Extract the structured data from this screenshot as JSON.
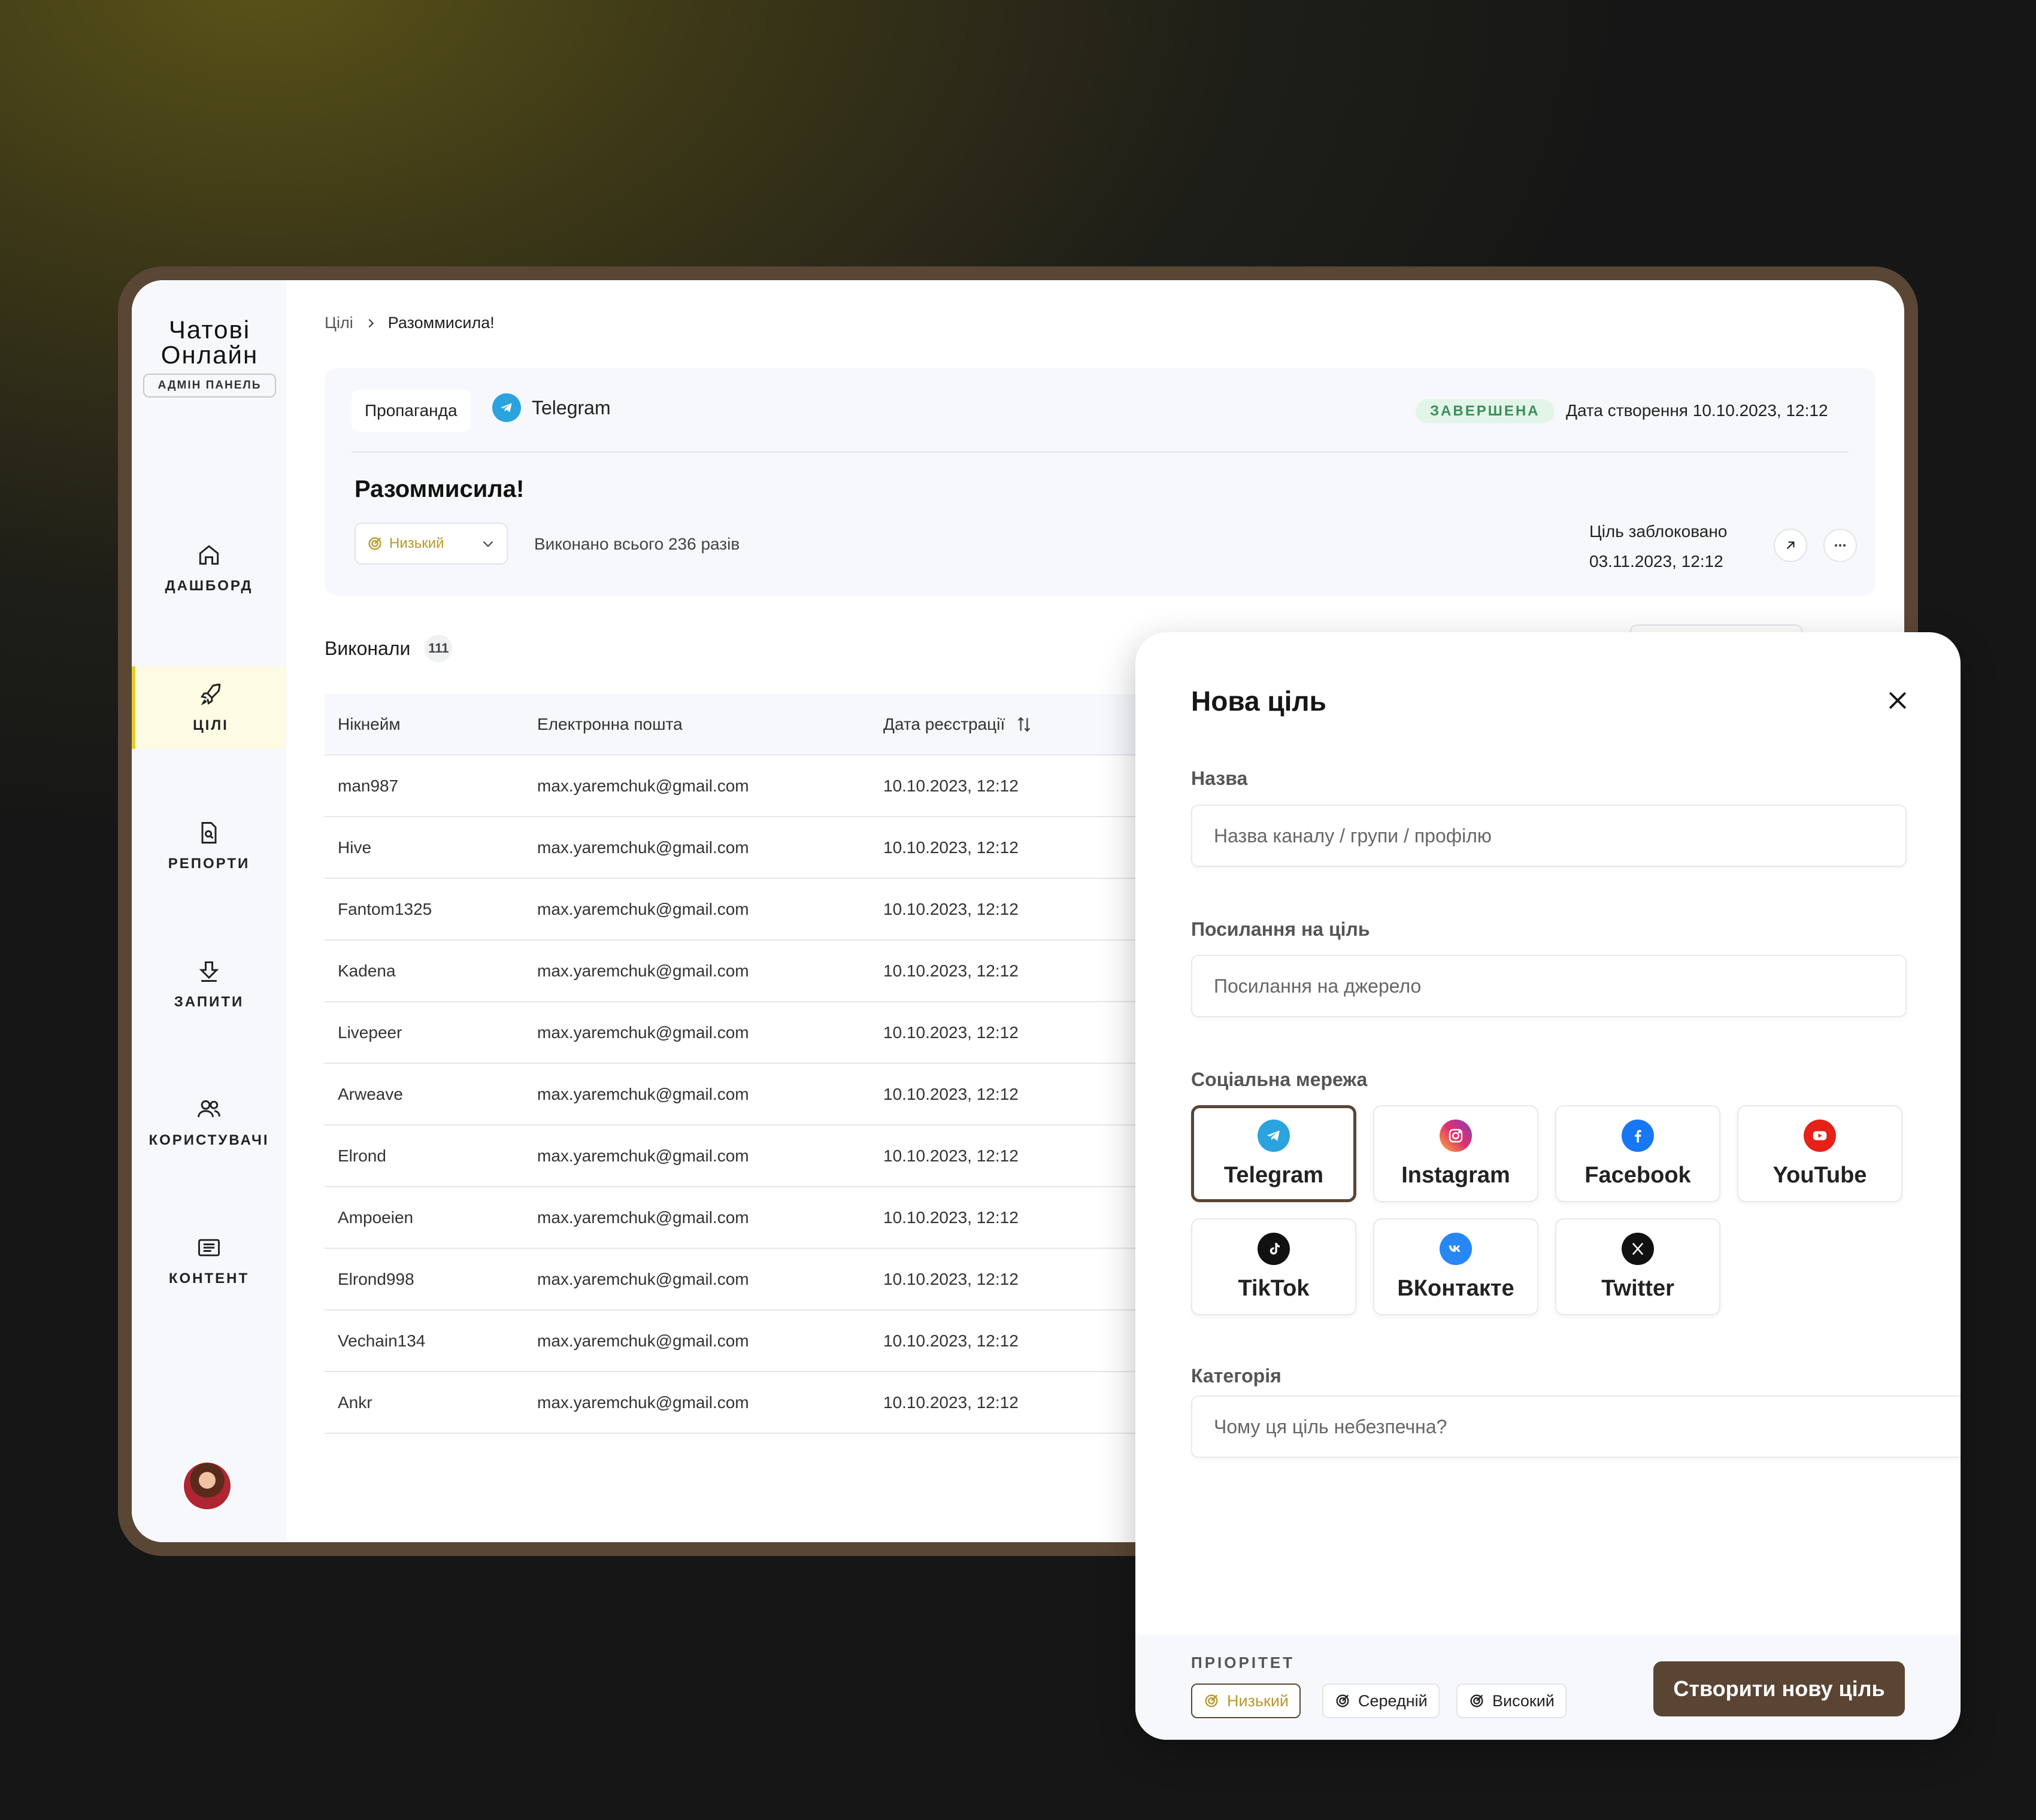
{
  "app": {
    "logo_top": "Чатові",
    "logo_bottom": "Онлайн",
    "badge": "АДМІН ПАНЕЛЬ"
  },
  "nav": [
    {
      "label": "ДАШБОРД",
      "icon": "home-icon",
      "active": false
    },
    {
      "label": "ЦІЛІ",
      "icon": "rocket-icon",
      "active": true
    },
    {
      "label": "РЕПОРТИ",
      "icon": "report-icon",
      "active": false
    },
    {
      "label": "ЗАПИТИ",
      "icon": "download-icon",
      "active": false
    },
    {
      "label": "КОРИСТУВАЧІ",
      "icon": "users-icon",
      "active": false
    },
    {
      "label": "КОНТЕНТ",
      "icon": "content-icon",
      "active": false
    }
  ],
  "breadcrumb": {
    "root": "Цілі",
    "current": "Разоммисила!"
  },
  "target": {
    "category": "Пропаганда",
    "network": "Telegram",
    "status": "ЗАВЕРШЕНА",
    "created": "Дата створення 10.10.2023, 12:12",
    "title": "Разоммисила!",
    "priority": "Низький",
    "done": "Виконано всього 236 разів",
    "blocked_label": "Ціль заблоковано",
    "blocked_date": "03.11.2023, 12:12"
  },
  "executors": {
    "label": "Виконали",
    "count": "111"
  },
  "table": {
    "headers": [
      "Нікнейм",
      "Електронна пошта",
      "Дата реєстрації"
    ],
    "rows": [
      [
        "man987",
        "max.yaremchuk@gmail.com",
        "10.10.2023, 12:12"
      ],
      [
        "Hive",
        "max.yaremchuk@gmail.com",
        "10.10.2023, 12:12"
      ],
      [
        "Fantom1325",
        "max.yaremchuk@gmail.com",
        "10.10.2023, 12:12"
      ],
      [
        "Kadena",
        "max.yaremchuk@gmail.com",
        "10.10.2023, 12:12"
      ],
      [
        "Livepeer",
        "max.yaremchuk@gmail.com",
        "10.10.2023, 12:12"
      ],
      [
        "Arweave",
        "max.yaremchuk@gmail.com",
        "10.10.2023, 12:12"
      ],
      [
        "Elrond",
        "max.yaremchuk@gmail.com",
        "10.10.2023, 12:12"
      ],
      [
        "Ampoeien",
        "max.yaremchuk@gmail.com",
        "10.10.2023, 12:12"
      ],
      [
        "Elrond998",
        "max.yaremchuk@gmail.com",
        "10.10.2023, 12:12"
      ],
      [
        "Vechain134",
        "max.yaremchuk@gmail.com",
        "10.10.2023, 12:12"
      ],
      [
        "Ankr",
        "max.yaremchuk@gmail.com",
        "10.10.2023, 12:12"
      ]
    ]
  },
  "modal": {
    "title": "Нова ціль",
    "name_label": "Назва",
    "name_placeholder": "Назва каналу / групи / профілю",
    "link_label": "Посилання на ціль",
    "link_placeholder": "Посилання на джерело",
    "social_label": "Соціальна мережа",
    "socials": [
      {
        "label": "Telegram",
        "icon": "telegram-icon",
        "color": "#2aa3df",
        "selected": true
      },
      {
        "label": "Instagram",
        "icon": "instagram-icon",
        "color": "#e1306c",
        "selected": false
      },
      {
        "label": "Facebook",
        "icon": "facebook-icon",
        "color": "#1877f2",
        "selected": false
      },
      {
        "label": "YouTube",
        "icon": "youtube-icon",
        "color": "#e62117",
        "selected": false
      },
      {
        "label": "TikTok",
        "icon": "tiktok-icon",
        "color": "#111111",
        "selected": false
      },
      {
        "label": "ВКонтакте",
        "icon": "vk-icon",
        "color": "#2787f5",
        "selected": false
      },
      {
        "label": "Twitter",
        "icon": "x-icon",
        "color": "#111111",
        "selected": false
      }
    ],
    "category_label": "Категорія",
    "category_placeholder": "Чому ця ціль небезпечна?",
    "priority_label": "ПРІОРІТЕТ",
    "priorities": [
      "Низький",
      "Середній",
      "Високий"
    ],
    "create": "Створити нову ціль"
  },
  "colors": {
    "brand": "#5a4535",
    "accent": "#e4cf2d",
    "status_bg": "#e3f5e8",
    "status_text": "#3a8f5a"
  }
}
